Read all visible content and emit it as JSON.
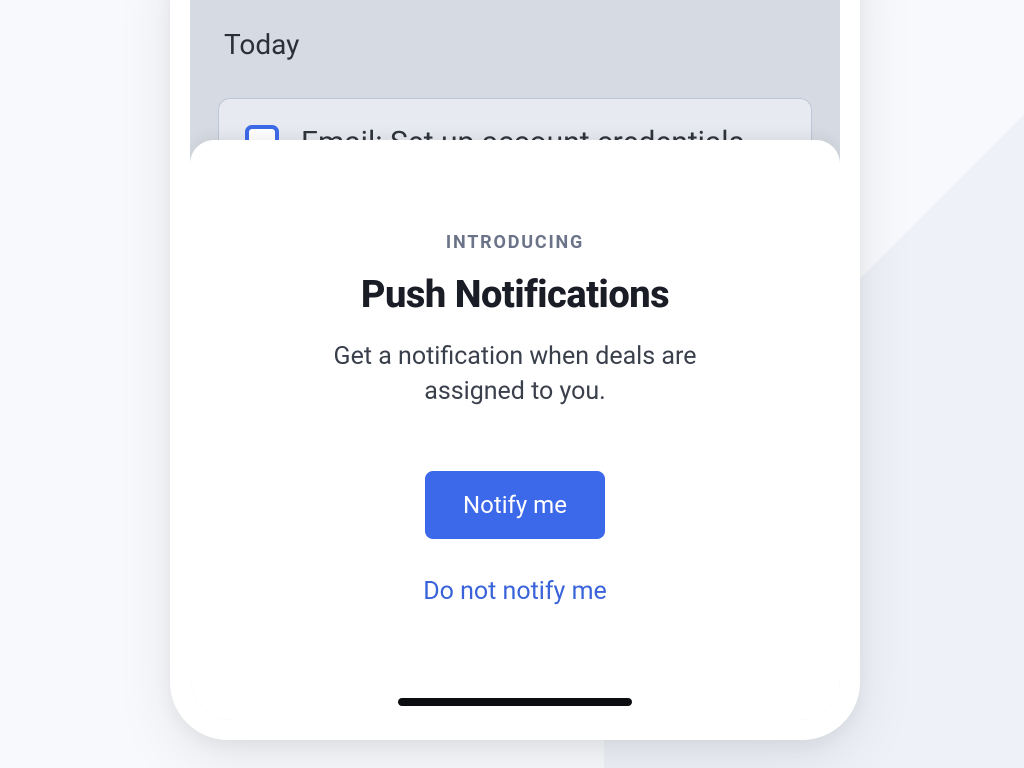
{
  "background": {
    "section_label": "Today",
    "task": {
      "label": "Email: Set up account credentials"
    }
  },
  "sheet": {
    "eyebrow": "INTRODUCING",
    "headline": "Push Notifications",
    "subcopy": "Get a notification when deals are assigned to you.",
    "primary_button": "Notify me",
    "secondary_button": "Do not notify me"
  },
  "colors": {
    "accent": "#3c68ea",
    "link": "#3963da",
    "text_primary": "#1a1d26",
    "text_secondary": "#6b7388"
  }
}
